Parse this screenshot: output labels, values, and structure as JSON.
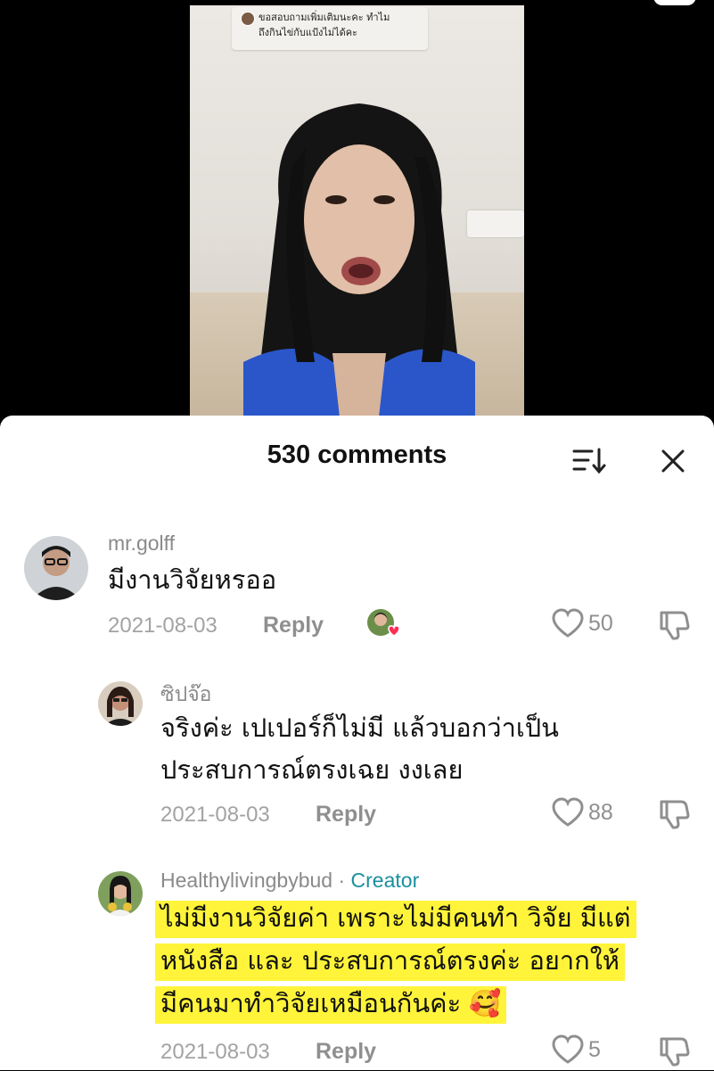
{
  "video": {
    "question_sticker": {
      "line1": "ขอสอบถามเพิ่มเติมนะคะ ทำไม",
      "line2": "ถึงกินไข่กับแป้งไม่ได้คะ"
    }
  },
  "sheet": {
    "title": "530 comments",
    "sort_icon": "sort-icon",
    "close_icon": "close-icon"
  },
  "comments": [
    {
      "username": "mr.golff",
      "text": "มีงานวิจัยหรออ",
      "date": "2021-08-03",
      "reply_label": "Reply",
      "likes": "50",
      "liked_by_creator": true
    },
    {
      "username": "ซิปจ๊อ",
      "text_lines": [
        "จริงค่ะ เปเปอร์ก็ไม่มี แล้วบอกว่าเป็น",
        "ประสบการณ์ตรงเฉย งงเลย"
      ],
      "date": "2021-08-03",
      "reply_label": "Reply",
      "likes": "88"
    },
    {
      "username": "Healthylivingbybud",
      "separator": " · ",
      "creator_badge": "Creator",
      "text_lines": [
        "ไม่มีงานวิจัยค่า เพราะไม่มีคนทำ วิจัย มีแต่",
        "หนังสือ และ ประสบการณ์ตรงค่ะ อยากให้",
        "มีคนมาทำวิจัยเหมือนกันค่ะ 🥰"
      ],
      "date": "2021-08-03",
      "reply_label": "Reply",
      "likes": "5"
    }
  ],
  "colors": {
    "creator": "#1a8fa0",
    "highlight": "#fff43a",
    "muted": "#8f8f8f"
  }
}
